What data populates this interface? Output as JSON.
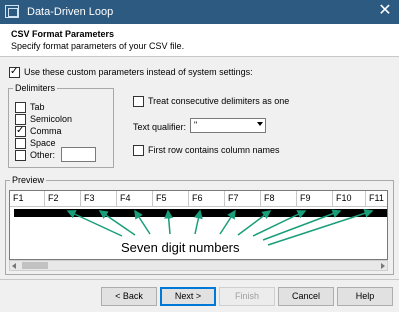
{
  "window": {
    "title": "Data-Driven Loop",
    "close_glyph": "✕"
  },
  "header": {
    "title": "CSV Format Parameters",
    "subtitle": "Specify format parameters of your CSV file."
  },
  "use_custom": {
    "label": "Use these custom parameters instead of system settings:",
    "checked": true
  },
  "delimiters": {
    "title": "Delimiters",
    "items": [
      {
        "label": "Tab",
        "checked": false
      },
      {
        "label": "Semicolon",
        "checked": false
      },
      {
        "label": "Comma",
        "checked": true
      },
      {
        "label": "Space",
        "checked": false
      },
      {
        "label": "Other:",
        "checked": false
      }
    ],
    "other_value": ""
  },
  "options": {
    "consecutive_label": "Treat consecutive delimiters as one",
    "consecutive_checked": false,
    "qualifier_label": "Text qualifier:",
    "qualifier_value": "\"",
    "first_row_label": "First row contains column names",
    "first_row_checked": false
  },
  "preview": {
    "title": "Preview",
    "columns": [
      "F1",
      "F2",
      "F3",
      "F4",
      "F5",
      "F6",
      "F7",
      "F8",
      "F9",
      "F10",
      "F11"
    ],
    "annotation": "Seven digit numbers",
    "annotation_color": "#1a9e7a"
  },
  "buttons": {
    "back": "< Back",
    "next": "Next >",
    "finish": "Finish",
    "cancel": "Cancel",
    "help": "Help"
  }
}
